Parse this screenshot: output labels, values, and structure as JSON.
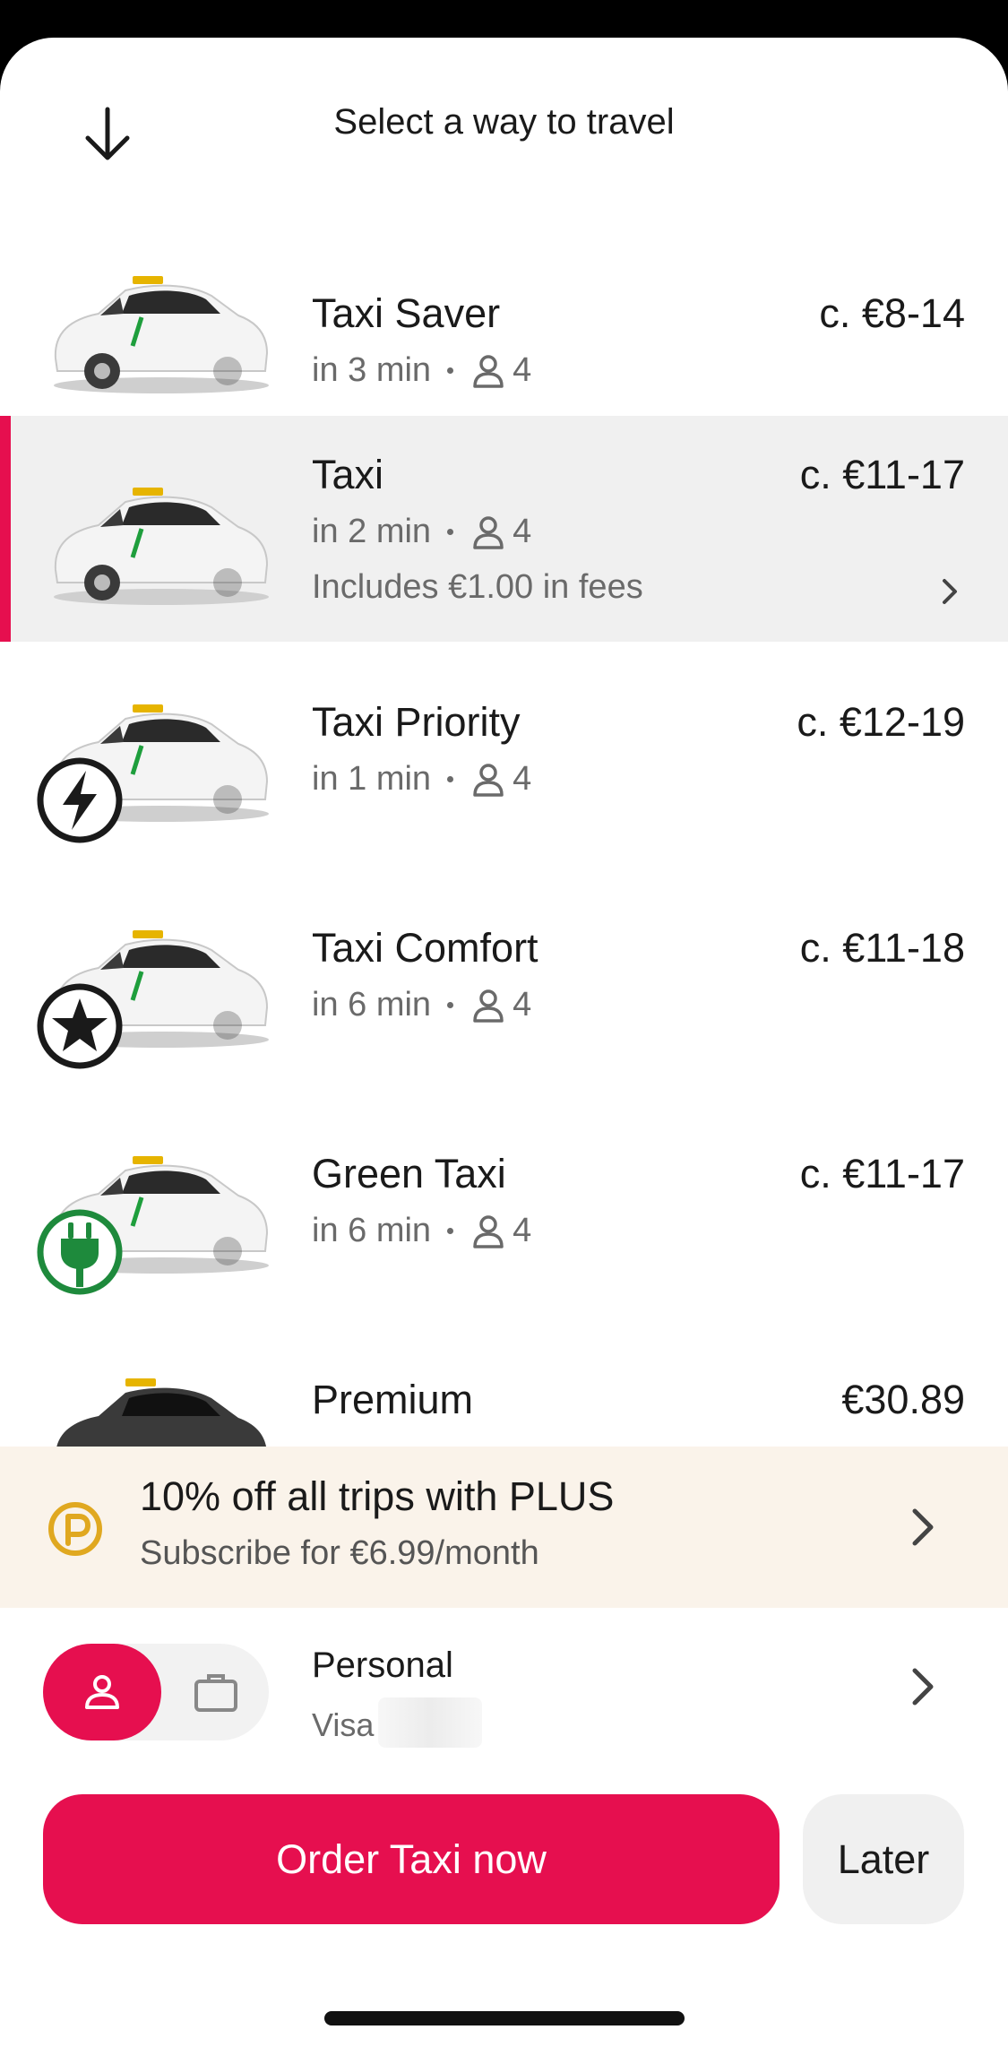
{
  "header": {
    "title": "Select a way to travel",
    "back_icon": "arrow-down-icon"
  },
  "rides": [
    {
      "name": "Taxi Saver",
      "price": "c. €8-14",
      "eta": "in 3 min",
      "seats": "4",
      "badge": "percent-icon",
      "selected": false
    },
    {
      "name": "Taxi",
      "price": "c. €11-17",
      "eta": "in 2 min",
      "seats": "4",
      "fees": "Includes €1.00 in fees",
      "selected": true
    },
    {
      "name": "Taxi Priority",
      "price": "c. €12-19",
      "eta": "in 1 min",
      "seats": "4",
      "badge": "lightning-icon",
      "selected": false
    },
    {
      "name": "Taxi Comfort",
      "price": "c. €11-18",
      "eta": "in 6 min",
      "seats": "4",
      "badge": "star-icon",
      "selected": false
    },
    {
      "name": "Green Taxi",
      "price": "c. €11-17",
      "eta": "in 6 min",
      "seats": "4",
      "badge": "plug-icon",
      "selected": false
    },
    {
      "name": "Premium",
      "price": "€30.89",
      "selected": false
    }
  ],
  "promo": {
    "title": "10% off all trips with PLUS",
    "subtitle": "Subscribe for €6.99/month"
  },
  "payment": {
    "profile": "Personal",
    "method": "Visa"
  },
  "actions": {
    "order": "Order Taxi now",
    "later": "Later"
  },
  "colors": {
    "accent": "#e60f4f",
    "promo_bg": "#faf3ea",
    "green": "#1e8a3c",
    "plus_gold": "#e0a820"
  }
}
